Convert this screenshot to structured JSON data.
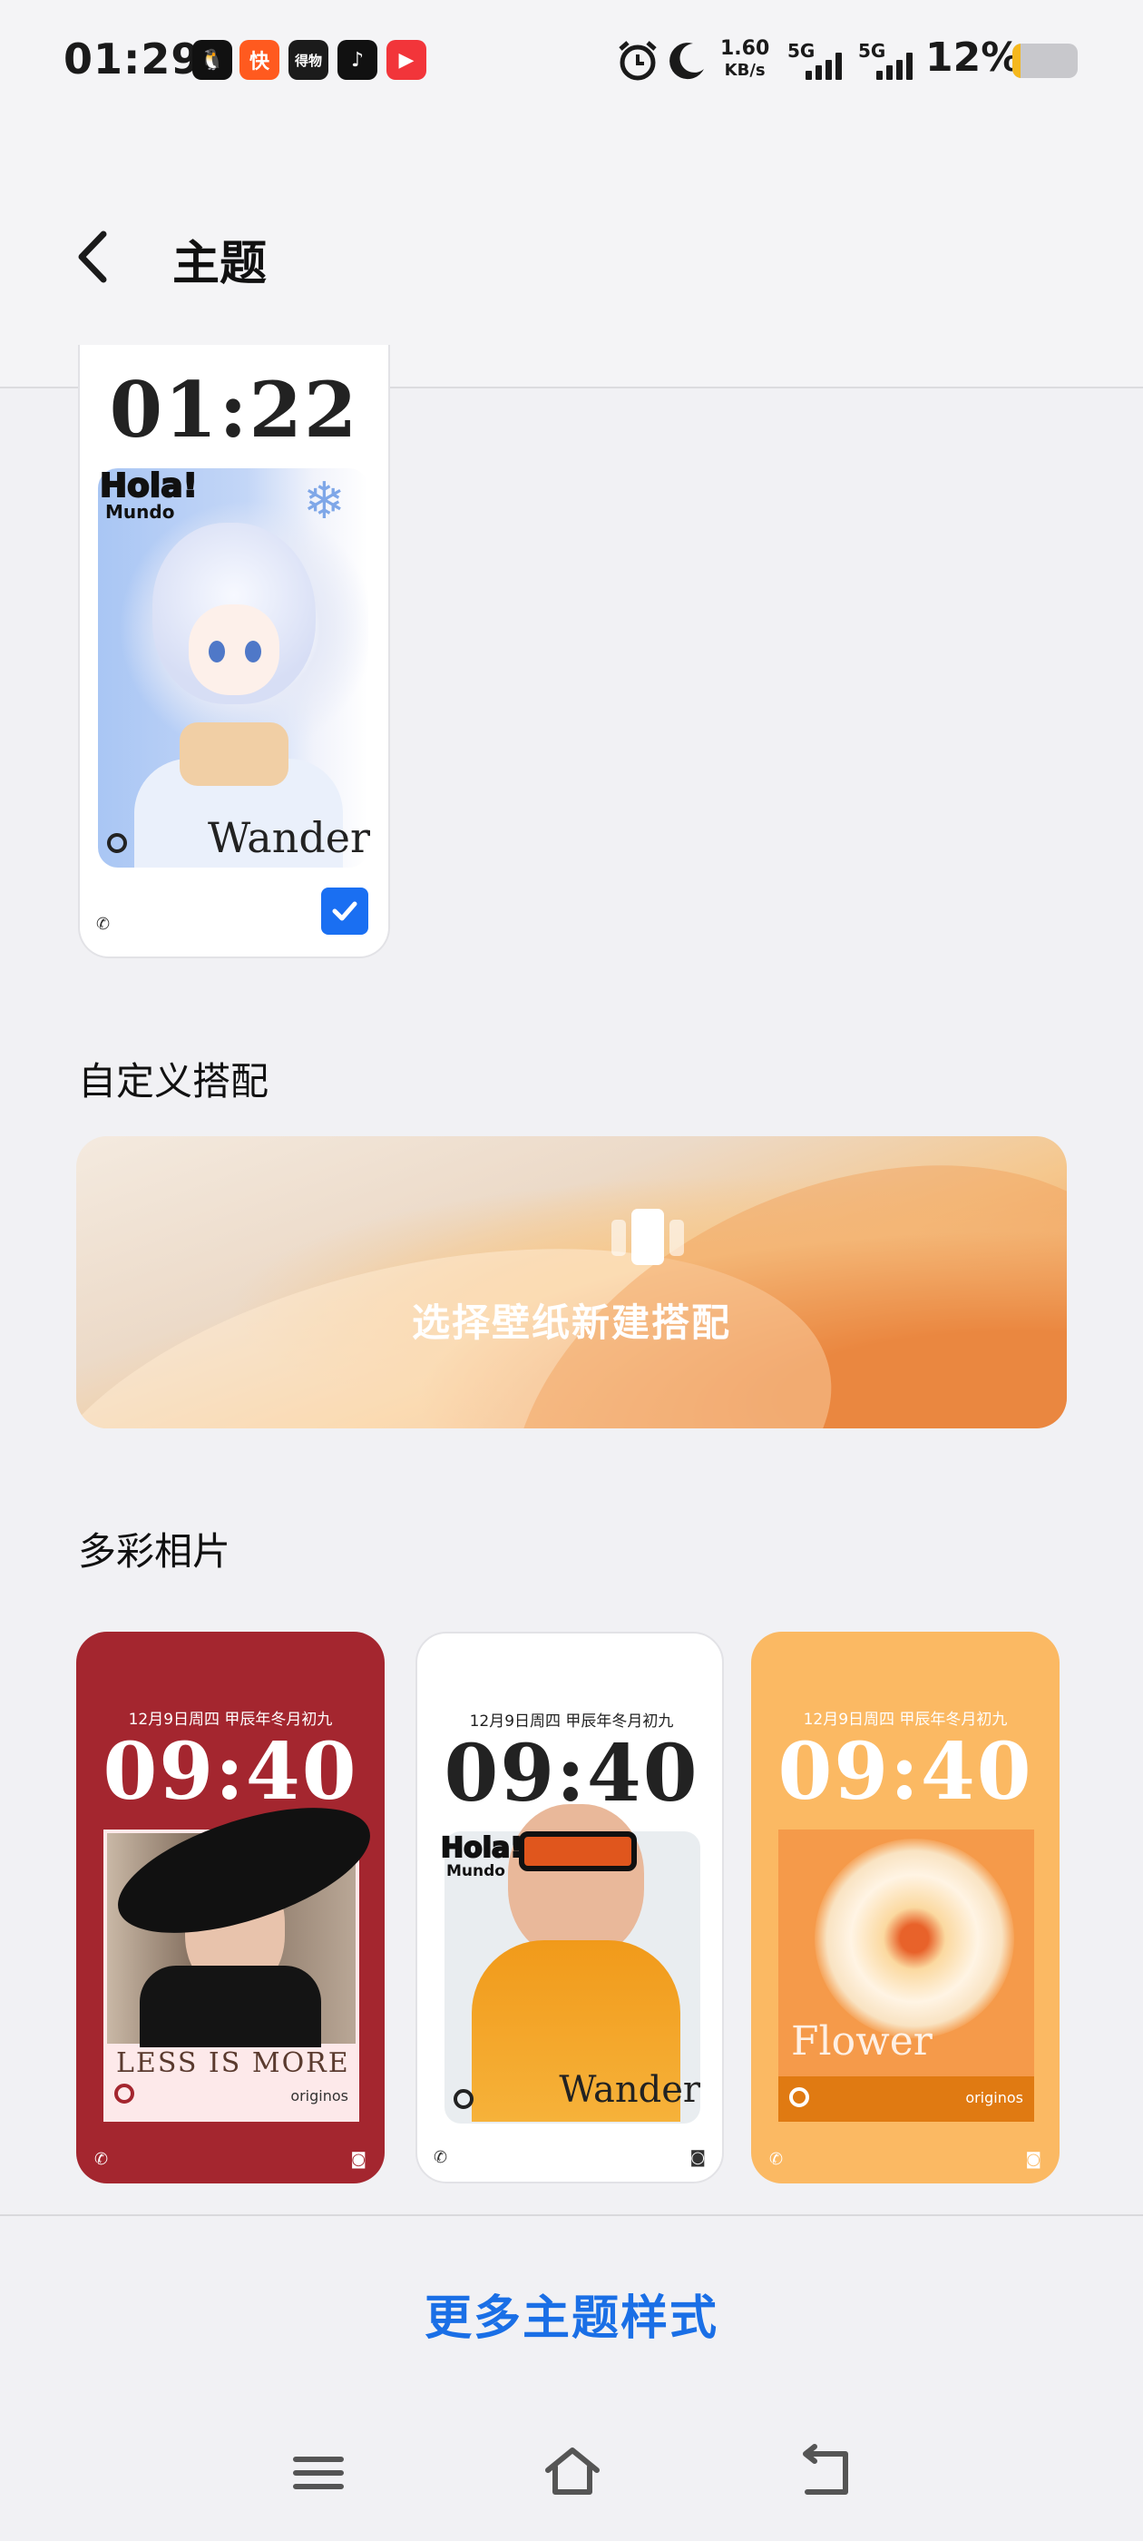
{
  "status_bar": {
    "time": "01:29",
    "app_icons": [
      {
        "name": "qq-icon",
        "color": "#111111",
        "glyph": "🐧"
      },
      {
        "name": "kuaishou-icon",
        "color": "#ff5a1f",
        "glyph": "快"
      },
      {
        "name": "dewu-icon",
        "color": "#1b1b1b",
        "glyph": "得物"
      },
      {
        "name": "douyin-icon",
        "color": "#111111",
        "glyph": "♪"
      },
      {
        "name": "video-app-icon",
        "color": "#f2353a",
        "glyph": "▶"
      }
    ],
    "speed_value": "1.60",
    "speed_unit": "KB/s",
    "network_1": "5G",
    "network_2": "5G",
    "battery_percent": "12%",
    "battery_level": 0.12,
    "battery_color": "#f5b81e"
  },
  "header": {
    "title": "主题"
  },
  "current_theme": {
    "time": "01:22",
    "badge_line1": "Hola!",
    "badge_line2": "Mundo",
    "signature": "Wander",
    "selected": true
  },
  "custom_section": {
    "title": "自定义搭配",
    "banner_label": "选择壁纸新建搭配"
  },
  "photos_section": {
    "title": "多彩相片",
    "cards": [
      {
        "date": "12月9日周四 甲辰年冬月初九",
        "time": "09:40",
        "caption": "LESS IS MORE",
        "brand": "originos",
        "background": "#a4262f",
        "text_color": "#ffffff"
      },
      {
        "date": "12月9日周四 甲辰年冬月初九",
        "time": "09:40",
        "badge_line1": "Hola!",
        "badge_line2": "Mundo",
        "caption": "Wander",
        "background": "#ffffff",
        "text_color": "#222222"
      },
      {
        "date": "12月9日周四 甲辰年冬月初九",
        "time": "09:40",
        "caption": "Flower",
        "brand": "originos",
        "background": "#fbb963",
        "text_color": "#ffffff"
      }
    ]
  },
  "more_link": "更多主题样式"
}
